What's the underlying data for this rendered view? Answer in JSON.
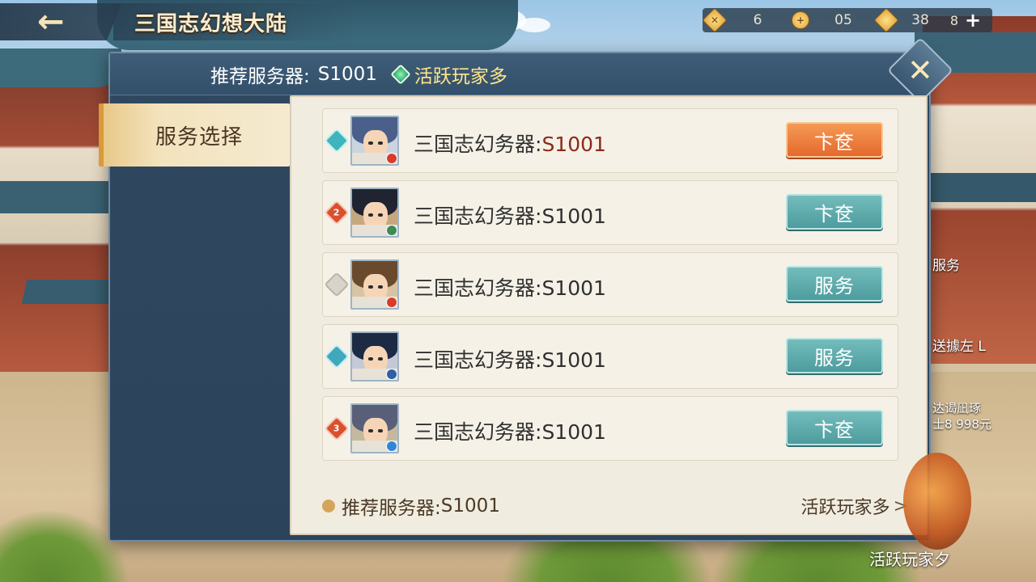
{
  "topbar": {
    "title": "三国志幻想大陆",
    "currencies": [
      {
        "icon": "gem-diamond-icon",
        "value": "6"
      },
      {
        "icon": "gold-coin-icon",
        "value": "05"
      },
      {
        "icon": "yuanbao-icon",
        "value": "38"
      }
    ],
    "last_value": "8"
  },
  "dialog": {
    "header_label": "推荐服务器:",
    "header_server": "S1001",
    "header_active": "活跃玩家多",
    "side_tab": "服务选择",
    "rows": [
      {
        "rank": "",
        "server": "三国志幻务器:",
        "id": "S1001",
        "button": "卞奁",
        "style": "orange",
        "hair": "#4a5f8a",
        "badge": "#d93b2b"
      },
      {
        "rank": "2",
        "server": "三国志幻务器:",
        "id": "S1001",
        "button": "卞奁",
        "style": "teal",
        "hair": "#1f2430",
        "badge": "#3f8a55"
      },
      {
        "rank": "",
        "server": "三国志幻务器:",
        "id": "S1001",
        "button": "服务",
        "style": "teal",
        "hair": "#6a4a2c",
        "badge": "#d93b2b"
      },
      {
        "rank": "",
        "server": "三国志幻务器:",
        "id": "S1001",
        "button": "服务",
        "style": "teal",
        "hair": "#1d2a44",
        "badge": "#2f5fa5"
      },
      {
        "rank": "3",
        "server": "三国志幻务器:",
        "id": "S1001",
        "button": "卞奁",
        "style": "teal",
        "hair": "#5a5f78",
        "badge": "#2e86d9"
      }
    ],
    "footer_label": "推荐服务器:",
    "footer_server": "S1001",
    "footer_link": "活跃玩家多"
  },
  "side_labels": {
    "label1": "服务",
    "label2": "送據左 L",
    "label3a": "达谒凪琢",
    "label3b": "士8 998元",
    "bottom": "活跃玩家夕"
  },
  "colors": {
    "accent_orange": "#e4692c",
    "accent_teal": "#4d9c9e",
    "dialog_bg": "#2f4860",
    "panel_bg": "#f1ece0",
    "highlight_yellow": "#ffe58a"
  }
}
